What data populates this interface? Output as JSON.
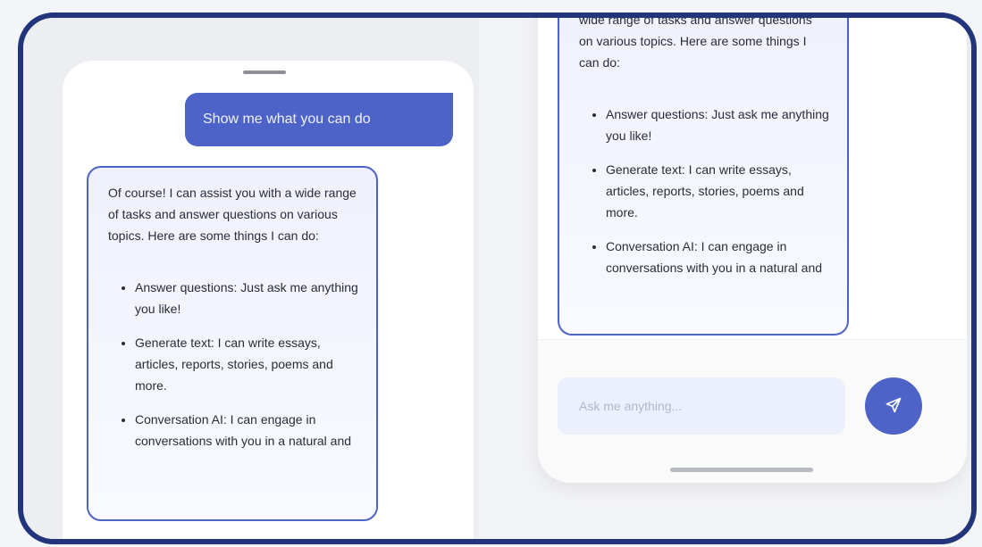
{
  "chat": {
    "user_message": "Show me what you can do",
    "ai_intro": "Of course! I can assist you with a wide range of tasks and answer questions on various topics. Here are some things I can do:",
    "ai_intro_tail_line1": "wide range of tasks and answer",
    "ai_intro_tail_rest": "questions on various topics. Here are some things I can do:",
    "capabilities": [
      "Answer questions: Just ask me anything you like!",
      "Generate text: I can write essays, articles, reports, stories, poems and more.",
      "Conversation AI: I can engage in conversations with you in a natural and"
    ]
  },
  "input": {
    "placeholder": "Ask me anything..."
  },
  "icons": {
    "send": "paper-plane-icon"
  },
  "colors": {
    "accent": "#4e63c7",
    "frame": "#22347a",
    "input_bg": "#eceffc"
  }
}
